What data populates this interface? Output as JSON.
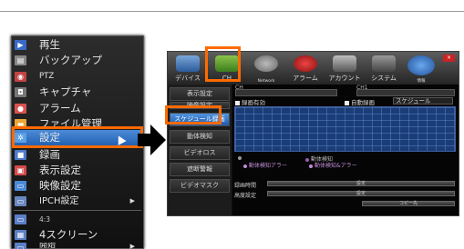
{
  "menu": {
    "items": [
      "再生",
      "バックアップ",
      "PTZ",
      "キャプチャ",
      "アラーム",
      "ファイル管理",
      "設定",
      "録画",
      "表示設定",
      "映像設定",
      "IPCH設定",
      "4:3",
      "4スクリーン",
      "開始"
    ]
  },
  "dvr": {
    "tabs": [
      "デバイス",
      "CH",
      "Network",
      "アラーム",
      "アカウント",
      "システム",
      "情報"
    ],
    "nav": [
      "表示設定",
      "映像設定",
      "スケジュール録画",
      "動体検知",
      "ビデオロス",
      "遮断警報",
      "ビデオマスク"
    ],
    "content": {
      "ch_label": "CH",
      "copy_ch_label": "CH1",
      "record_enable": "録画有効",
      "auto_record": "自動録画",
      "schedule_value": "スケジュール",
      "legend": [
        "動体検知アラー",
        "動体検知",
        "動体検知&アラー"
      ],
      "record_time_label": "録画時間",
      "record_time_btn": "設定",
      "advanced_label": "高度設定",
      "advanced_btn": "設定",
      "copy_btn": "コピー先"
    }
  },
  "colors": {
    "highlight": "#ff6a00",
    "selection": "#2f74c8",
    "menu_background": "#1c1c1c"
  }
}
